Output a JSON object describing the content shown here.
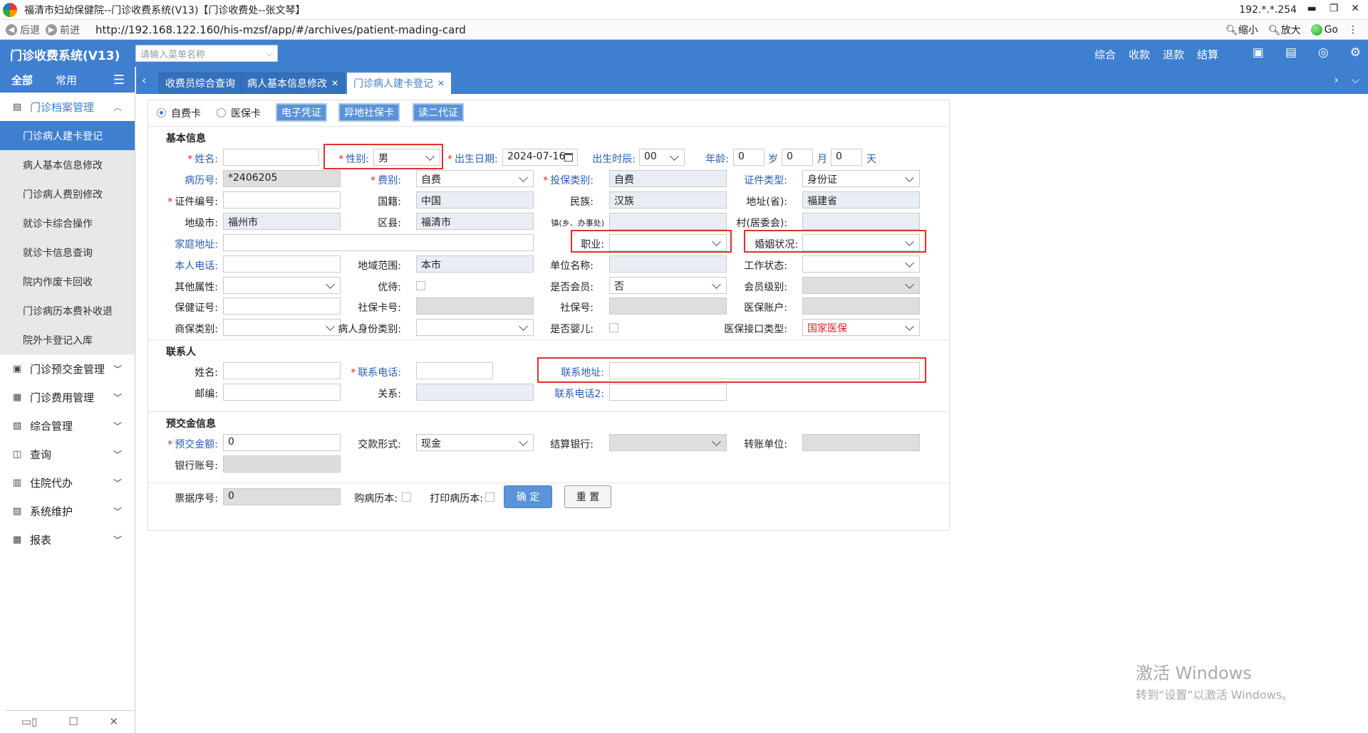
{
  "window": {
    "title": "福清市妇幼保健院--门诊收费系统(V13)【门诊收费处--张文琴】",
    "ip": "192.*.*.254"
  },
  "browser": {
    "back": "后退",
    "forward": "前进",
    "url": "http://192.168.122.160/his-mzsf/app/#/archives/patient-mading-card",
    "zoom_out": "缩小",
    "zoom_in": "放大",
    "go": "Go"
  },
  "header": {
    "brand": "门诊收费系统(V13)",
    "menu_search_placeholder": "请输入菜单名称",
    "nav": [
      "综合",
      "收款",
      "退款",
      "结算"
    ],
    "accent": "#3f7fcf"
  },
  "sidebar": {
    "tabs": [
      "全部",
      "常用"
    ],
    "groups": [
      {
        "label": "门诊档案管理",
        "icon": "archive-icon",
        "open": true,
        "items": [
          "门诊病人建卡登记",
          "病人基本信息修改",
          "门诊病人费别修改",
          "就诊卡综合操作",
          "就诊卡信息查询",
          "院内作废卡回收",
          "门诊病历本费补收退",
          "院外卡登记入库"
        ]
      },
      {
        "label": "门诊预交金管理",
        "icon": "deposit-icon"
      },
      {
        "label": "门诊费用管理",
        "icon": "fee-icon"
      },
      {
        "label": "综合管理",
        "icon": "manage-icon"
      },
      {
        "label": "查询",
        "icon": "query-icon"
      },
      {
        "label": "住院代办",
        "icon": "inpatient-icon"
      },
      {
        "label": "系统维护",
        "icon": "system-icon"
      },
      {
        "label": "报表",
        "icon": "report-icon"
      }
    ]
  },
  "tabs": [
    {
      "label": "收费员综合查询",
      "closable": false
    },
    {
      "label": "病人基本信息修改",
      "closable": true
    },
    {
      "label": "门诊病人建卡登记",
      "closable": true,
      "active": true
    }
  ],
  "form": {
    "card_type": {
      "self_pay": "自费卡",
      "insurance": "医保卡",
      "selected": "自费卡"
    },
    "toolbar": [
      "电子凭证",
      "异地社保卡",
      "读二代证"
    ],
    "sections": {
      "basic": "基本信息",
      "contact": "联系人",
      "deposit": "预交金信息"
    },
    "labels": {
      "name": "姓名:",
      "gender": "性别:",
      "birth_date": "出生日期:",
      "birth_hour": "出生时辰:",
      "age": "年龄:",
      "age_year": "岁",
      "age_month": "月",
      "age_day": "天",
      "record_no": "病历号:",
      "fee_type": "费别:",
      "insurance_category": "投保类别:",
      "id_type": "证件类型:",
      "id_no": "证件编号:",
      "nationality": "国籍:",
      "ethnicity": "民族:",
      "province": "地址(省):",
      "city": "地级市:",
      "county": "区县:",
      "town": "镇(乡、办事处)",
      "village": "村(居委会):",
      "home_address": "家庭地址:",
      "occupation": "职业:",
      "marital_status": "婚姻状况:",
      "phone": "本人电话:",
      "region_scope": "地域范围:",
      "employer": "单位名称:",
      "work_status": "工作状态:",
      "other_attr": "其他属性:",
      "preferential": "优待:",
      "is_member": "是否会员:",
      "member_level": "会员级别:",
      "health_no": "保健证号:",
      "social_card_no": "社保卡号:",
      "social_no": "社保号:",
      "insurance_account": "医保账户:",
      "commercial_insurance": "商保类别:",
      "patient_identity": "病人身份类别:",
      "is_infant": "是否婴儿:",
      "insurance_interface": "医保接口类型:",
      "contact_name": "姓名:",
      "contact_phone": "联系电话:",
      "contact_address": "联系地址:",
      "postcode": "邮编:",
      "relation": "关系:",
      "contact_phone2": "联系电话2:",
      "deposit_amount": "预交金额:",
      "payment_method": "交款形式:",
      "settle_bank": "结算银行:",
      "transfer_unit": "转账单位:",
      "bank_account": "银行账号:",
      "receipt_no": "票据序号:",
      "buy_record_book": "购病历本:",
      "print_record_book": "打印病历本:"
    },
    "values": {
      "name": "",
      "gender": "男",
      "birth_date": "2024-07-16",
      "birth_hour": "00",
      "age_year": "0",
      "age_month": "0",
      "age_day": "0",
      "record_no": "*2406205",
      "fee_type": "自费",
      "insurance_category": "自费",
      "id_type": "身份证",
      "id_no": "",
      "nationality": "中国",
      "ethnicity": "汉族",
      "province": "福建省",
      "city": "福州市",
      "county": "福清市",
      "town": "",
      "village": "",
      "home_address": "",
      "occupation": "",
      "marital_status": "",
      "phone": "",
      "region_scope": "本市",
      "employer": "",
      "work_status": "",
      "other_attr": "",
      "is_member": "否",
      "member_level": "",
      "health_no": "",
      "social_card_no": "",
      "social_no": "",
      "insurance_account": "",
      "commercial_insurance": "",
      "patient_identity": "",
      "insurance_interface": "国家医保",
      "contact_name": "",
      "contact_phone": "",
      "contact_address": "",
      "postcode": "",
      "relation": "",
      "contact_phone2": "",
      "deposit_amount": "0",
      "payment_method": "现金",
      "settle_bank": "",
      "transfer_unit": "",
      "bank_account": "",
      "receipt_no": "0"
    },
    "buttons": {
      "confirm": "确 定",
      "reset": "重 置"
    }
  },
  "watermark": {
    "line1": "激活 Windows",
    "line2": "转到“设置”以激活 Windows。"
  }
}
